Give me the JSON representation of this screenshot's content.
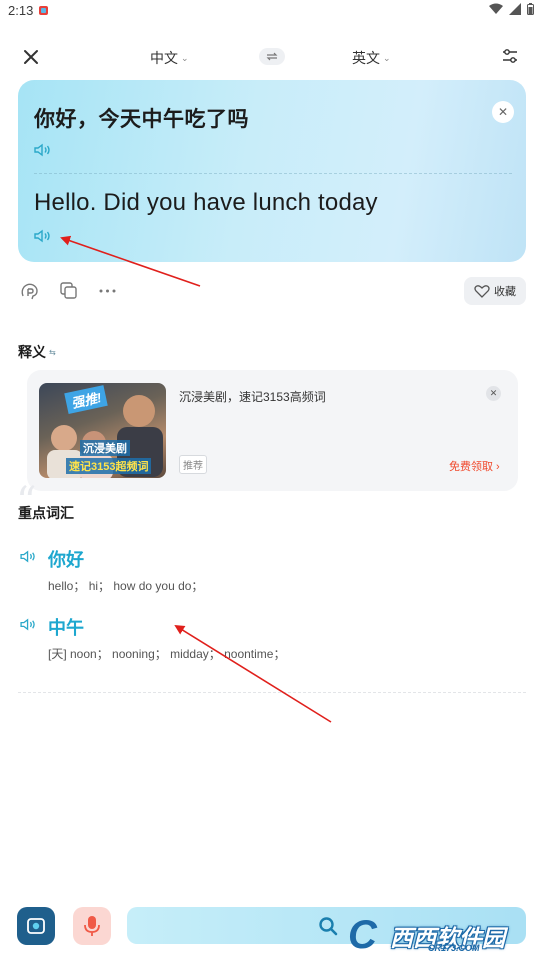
{
  "status_bar": {
    "time": "2:13"
  },
  "header": {
    "source_lang": "中文",
    "target_lang": "英文"
  },
  "translation": {
    "source_text": "你好，今天中午吃了吗",
    "target_text": "Hello. Did you have lunch today"
  },
  "actions": {
    "favorite_label": "收藏"
  },
  "definition": {
    "title": "释义",
    "ad": {
      "title": "沉浸美剧，速记3153高频词",
      "tag": "推荐",
      "cta": "免费领取 ›",
      "image_badge": "强推!",
      "image_line1": "沉浸美剧",
      "image_line2": "速记3153超频词"
    }
  },
  "vocab": {
    "title": "重点词汇",
    "items": [
      {
        "word": "你好",
        "definition": "hello； hi； how do you do；"
      },
      {
        "word": "中午",
        "definition": "[天] noon； nooning； midday； noontime；"
      }
    ]
  },
  "watermark": {
    "name": "西西软件园",
    "url": "CR173.COM"
  },
  "colors": {
    "accent": "#1da7cf",
    "card_bg": "#c8edf9",
    "cta": "#f04a2d",
    "annotation_arrow": "#e0201c"
  }
}
